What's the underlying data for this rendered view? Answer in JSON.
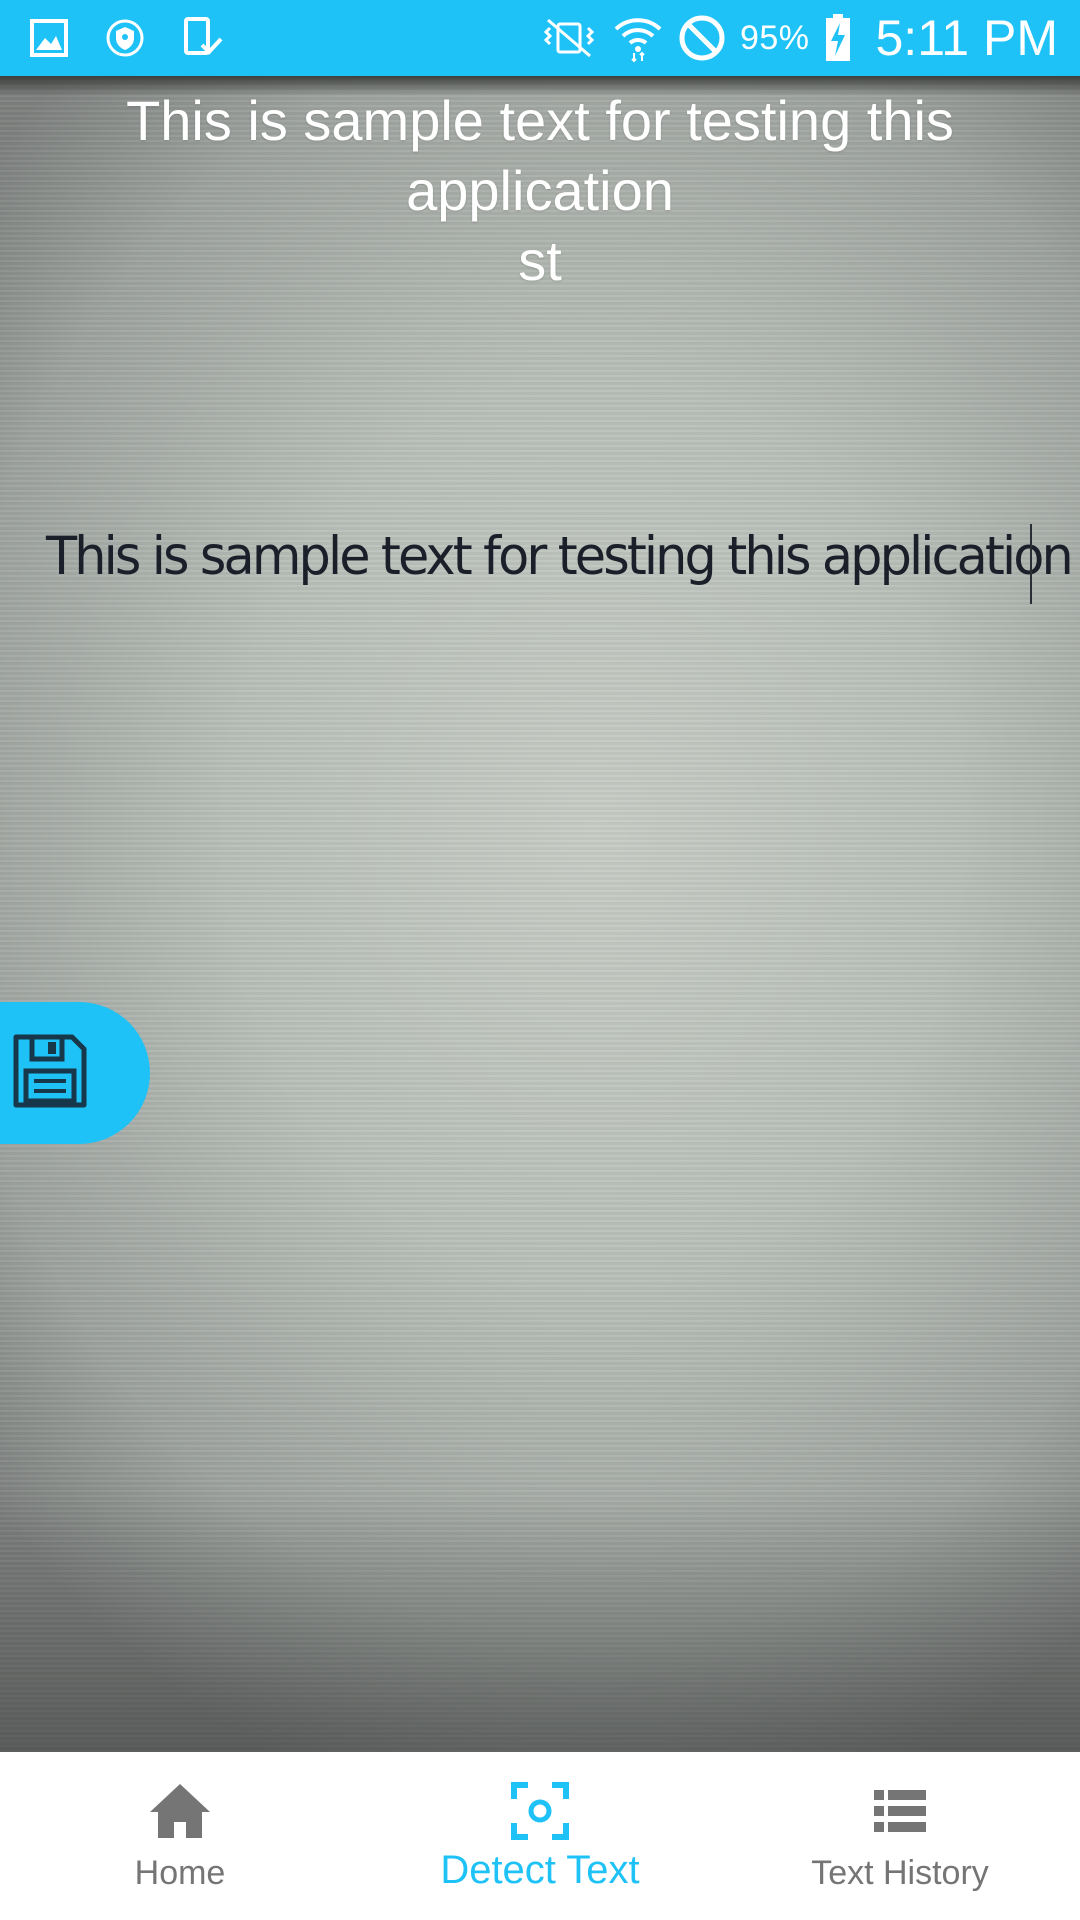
{
  "colors": {
    "accent": "#1ec2f7",
    "nav_inactive": "#757575",
    "nav_background": "#ffffff"
  },
  "status_bar": {
    "left_icons": [
      "gallery-icon",
      "shield-icon",
      "device-check-icon"
    ],
    "right_icons": [
      "vibrate-icon",
      "wifi-icon",
      "do-not-disturb-icon",
      "battery-charging-icon"
    ],
    "battery_percent": "95%",
    "time": "5:11 PM"
  },
  "camera": {
    "detected_text_lines": [
      "This is sample text for testing this",
      "application",
      "st"
    ],
    "paper_text": "This is sample text for testing this application"
  },
  "save_fab": {
    "icon": "floppy-disk-icon"
  },
  "bottom_nav": {
    "items": [
      {
        "label": "Home",
        "icon": "home-icon",
        "active": false
      },
      {
        "label": "Detect Text",
        "icon": "scan-icon",
        "active": true
      },
      {
        "label": "Text History",
        "icon": "list-icon",
        "active": false
      }
    ]
  }
}
